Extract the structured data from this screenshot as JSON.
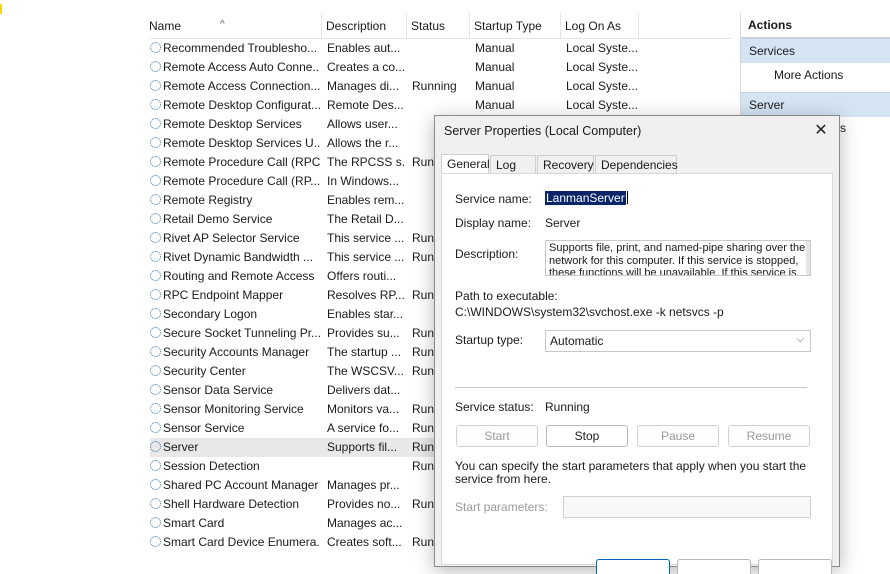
{
  "services_list": {
    "columns": [
      "Name",
      "Description",
      "Status",
      "Startup Type",
      "Log On As"
    ],
    "rows": [
      {
        "name": "Recommended Troublesho...",
        "desc": "Enables aut...",
        "status": "",
        "startup": "Manual",
        "logon": "Local Syste..."
      },
      {
        "name": "Remote Access Auto Conne...",
        "desc": "Creates a co...",
        "status": "",
        "startup": "Manual",
        "logon": "Local Syste..."
      },
      {
        "name": "Remote Access Connection...",
        "desc": "Manages di...",
        "status": "Running",
        "startup": "Manual",
        "logon": "Local Syste..."
      },
      {
        "name": "Remote Desktop Configurat...",
        "desc": "Remote Des...",
        "status": "",
        "startup": "Manual",
        "logon": "Local Syste..."
      },
      {
        "name": "Remote Desktop Services",
        "desc": "Allows user...",
        "status": "",
        "startup": "",
        "logon": ""
      },
      {
        "name": "Remote Desktop Services U...",
        "desc": "Allows the r...",
        "status": "",
        "startup": "",
        "logon": ""
      },
      {
        "name": "Remote Procedure Call (RPC)",
        "desc": "The RPCSS s...",
        "status": "Run",
        "startup": "",
        "logon": ""
      },
      {
        "name": "Remote Procedure Call (RP...",
        "desc": "In Windows...",
        "status": "",
        "startup": "",
        "logon": ""
      },
      {
        "name": "Remote Registry",
        "desc": "Enables rem...",
        "status": "",
        "startup": "",
        "logon": ""
      },
      {
        "name": "Retail Demo Service",
        "desc": "The Retail D...",
        "status": "",
        "startup": "",
        "logon": ""
      },
      {
        "name": "Rivet AP Selector Service",
        "desc": "This service ...",
        "status": "Run",
        "startup": "",
        "logon": ""
      },
      {
        "name": "Rivet Dynamic Bandwidth ...",
        "desc": "This service ...",
        "status": "Run",
        "startup": "",
        "logon": ""
      },
      {
        "name": "Routing and Remote Access",
        "desc": "Offers routi...",
        "status": "",
        "startup": "",
        "logon": ""
      },
      {
        "name": "RPC Endpoint Mapper",
        "desc": "Resolves RP...",
        "status": "Run",
        "startup": "",
        "logon": ""
      },
      {
        "name": "Secondary Logon",
        "desc": "Enables star...",
        "status": "",
        "startup": "",
        "logon": ""
      },
      {
        "name": "Secure Socket Tunneling Pr...",
        "desc": "Provides su...",
        "status": "Run",
        "startup": "",
        "logon": ""
      },
      {
        "name": "Security Accounts Manager",
        "desc": "The startup ...",
        "status": "Run",
        "startup": "",
        "logon": ""
      },
      {
        "name": "Security Center",
        "desc": "The WSCSV...",
        "status": "Run",
        "startup": "",
        "logon": ""
      },
      {
        "name": "Sensor Data Service",
        "desc": "Delivers dat...",
        "status": "",
        "startup": "",
        "logon": ""
      },
      {
        "name": "Sensor Monitoring Service",
        "desc": "Monitors va...",
        "status": "Run",
        "startup": "",
        "logon": ""
      },
      {
        "name": "Sensor Service",
        "desc": "A service fo...",
        "status": "Run",
        "startup": "",
        "logon": ""
      },
      {
        "name": "Server",
        "desc": "Supports fil...",
        "status": "Run",
        "startup": "",
        "logon": "",
        "selected": true
      },
      {
        "name": "Session Detection",
        "desc": "",
        "status": "Run",
        "startup": "",
        "logon": ""
      },
      {
        "name": "Shared PC Account Manager",
        "desc": "Manages pr...",
        "status": "",
        "startup": "",
        "logon": ""
      },
      {
        "name": "Shell Hardware Detection",
        "desc": "Provides no...",
        "status": "Run",
        "startup": "",
        "logon": ""
      },
      {
        "name": "Smart Card",
        "desc": "Manages ac...",
        "status": "",
        "startup": "",
        "logon": ""
      },
      {
        "name": "Smart Card Device Enumera...",
        "desc": "Creates soft...",
        "status": "Run",
        "startup": "",
        "logon": ""
      }
    ]
  },
  "actions": {
    "title": "Actions",
    "group1": "Services",
    "more_actions": "More Actions",
    "group2": "Server",
    "item_partial": "s"
  },
  "dialog": {
    "title": "Server Properties (Local Computer)",
    "tabs": [
      "General",
      "Log On",
      "Recovery",
      "Dependencies"
    ],
    "service_name_label": "Service name:",
    "service_name_value": "LanmanServer",
    "display_name_label": "Display name:",
    "display_name_value": "Server",
    "description_label": "Description:",
    "description_value": "Supports file, print, and named-pipe sharing over the network for this computer. If this service is stopped, these functions will be unavailable. If this service is",
    "path_label": "Path to executable:",
    "path_value": "C:\\WINDOWS\\system32\\svchost.exe -k netsvcs -p",
    "startup_type_label": "Startup type:",
    "startup_type_value": "Automatic",
    "service_status_label": "Service status:",
    "service_status_value": "Running",
    "buttons": {
      "start": "Start",
      "stop": "Stop",
      "pause": "Pause",
      "resume": "Resume"
    },
    "note": "You can specify the start parameters that apply when you start the service from here.",
    "start_params_label": "Start parameters:"
  }
}
